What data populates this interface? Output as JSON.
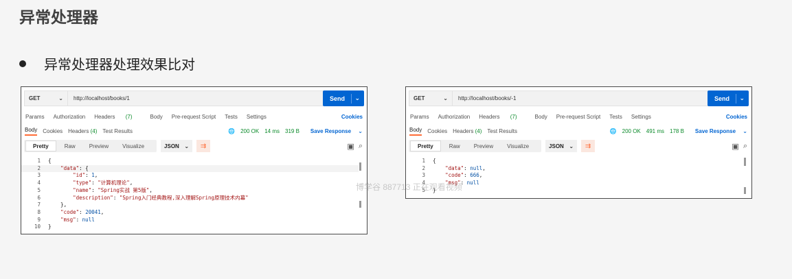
{
  "slide": {
    "title": "异常处理器",
    "bullet": "异常处理器处理效果比对"
  },
  "tabs": {
    "params": "Params",
    "authorization": "Authorization",
    "headers_label": "Headers",
    "headers_count": "(7)",
    "body": "Body",
    "prerequest": "Pre-request Script",
    "tests": "Tests",
    "settings": "Settings",
    "cookies": "Cookies"
  },
  "response_tabs": {
    "body": "Body",
    "cookies": "Cookies",
    "headers_label": "Headers",
    "headers_count": "(4)",
    "test_results": "Test Results",
    "save_response": "Save Response"
  },
  "viewbar": {
    "pretty": "Pretty",
    "raw": "Raw",
    "preview": "Preview",
    "visualize": "Visualize",
    "format": "JSON"
  },
  "method": "GET",
  "send_label": "Send",
  "left": {
    "url": "http://localhost/books/1",
    "status": "200 OK",
    "time": "14 ms",
    "size": "319 B",
    "lines": [
      {
        "n": "1",
        "t": "{"
      },
      {
        "n": "2",
        "t": "    \"data\": {"
      },
      {
        "n": "3",
        "t": "        \"id\": 1,"
      },
      {
        "n": "4",
        "t": "        \"type\": \"计算机理论\","
      },
      {
        "n": "5",
        "t": "        \"name\": \"Spring实战 第5版\","
      },
      {
        "n": "6",
        "t": "        \"description\": \"Spring入门经典教程,深入理解Spring原理技术内幕\""
      },
      {
        "n": "7",
        "t": "    },"
      },
      {
        "n": "8",
        "t": "    \"code\": 20041,"
      },
      {
        "n": "9",
        "t": "    \"msg\": null"
      },
      {
        "n": "10",
        "t": "}"
      }
    ]
  },
  "right": {
    "url": "http://localhost/books/-1",
    "status": "200 OK",
    "time": "491 ms",
    "size": "178 B",
    "lines": [
      {
        "n": "1",
        "t": "{"
      },
      {
        "n": "2",
        "t": "    \"data\": null,"
      },
      {
        "n": "3",
        "t": "    \"code\": 666,"
      },
      {
        "n": "4",
        "t": "    \"msg\": null"
      },
      {
        "n": "5",
        "t": "}"
      }
    ]
  },
  "watermark": "博学谷 887713 正在观看视频",
  "colors": {
    "accent": "#0265d2",
    "active_tab": "#ff6c37",
    "status_ok": "#0b8a2a"
  }
}
